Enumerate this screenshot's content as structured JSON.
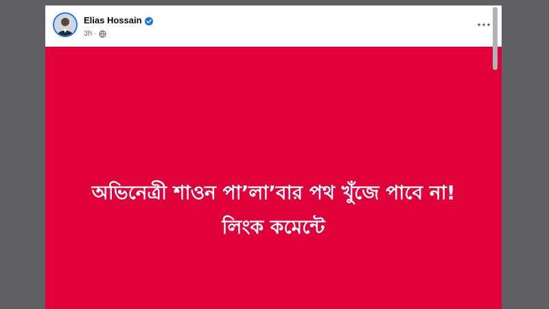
{
  "post": {
    "author": {
      "name": "Elias Hossain",
      "verified": true,
      "avatar_icon": "profile-photo"
    },
    "time": "3h",
    "privacy_icon": "globe-icon",
    "menu_icon": "more-options-icon",
    "image": {
      "background_color": "#e0003a",
      "text_color": "#ffffff",
      "line1": "অভিনেত্রী শাওন পা’লা’বার পথ খুঁজে পাবে না!",
      "line2": "লিংক কমেন্টে"
    }
  },
  "colors": {
    "page_background": "#5f6063",
    "verified_badge": "#1b74e4",
    "meta_text": "#65676b"
  }
}
